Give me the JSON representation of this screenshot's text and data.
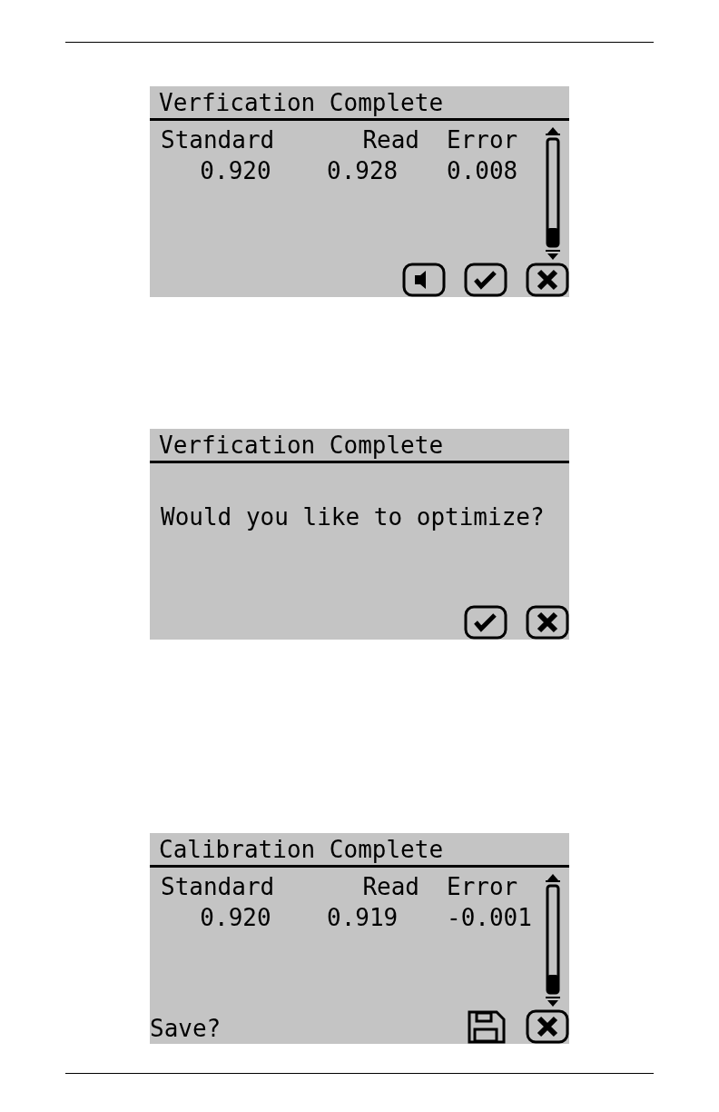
{
  "screens": [
    {
      "kind": "table",
      "title": "Verfication Complete",
      "columns": [
        "Standard",
        "Read",
        "Error"
      ],
      "values": [
        "0.920",
        "0.928",
        "0.008"
      ],
      "buttons": [
        {
          "kind": "speaker"
        },
        {
          "kind": "ok"
        },
        {
          "kind": "cancel"
        }
      ]
    },
    {
      "kind": "message",
      "title": "Verfication Complete",
      "message": "Would you like to optimize?",
      "buttons": [
        {
          "kind": "ok"
        },
        {
          "kind": "cancel"
        }
      ]
    },
    {
      "kind": "table",
      "title": "Calibration Complete",
      "columns": [
        "Standard",
        "Read",
        "Error"
      ],
      "values": [
        "0.920",
        "0.919",
        "-0.001"
      ],
      "prompt": "Save?",
      "buttons": [
        {
          "kind": "save"
        },
        {
          "kind": "cancel"
        }
      ]
    }
  ]
}
